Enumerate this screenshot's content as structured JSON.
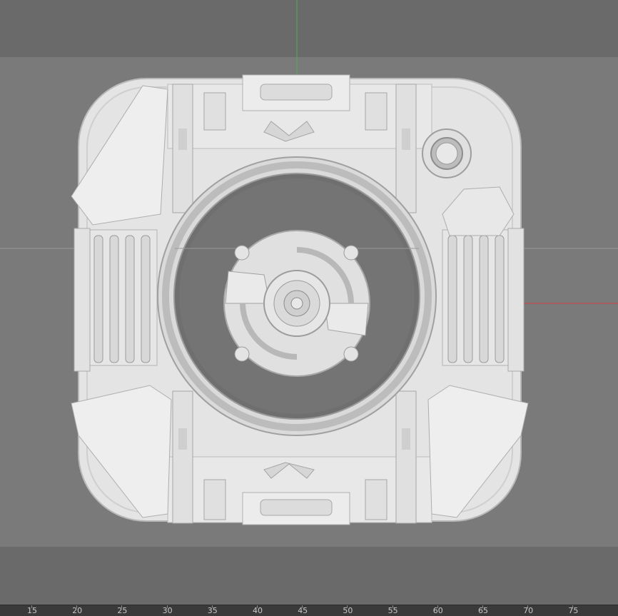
{
  "viewport": {
    "background_color": "#7a7a7a",
    "band_color": "#6a6a6a",
    "model_color": "#e6e6e6",
    "axis_colors": {
      "y_axis": "#4caf50",
      "x_axis": "#d04040",
      "horizon_line": "#a0a0a0"
    }
  },
  "ruler": {
    "background": "#3a3a3a",
    "labels": [
      "15",
      "20",
      "25",
      "30",
      "35",
      "40",
      "45",
      "50",
      "55",
      "60",
      "65",
      "70",
      "75"
    ]
  }
}
